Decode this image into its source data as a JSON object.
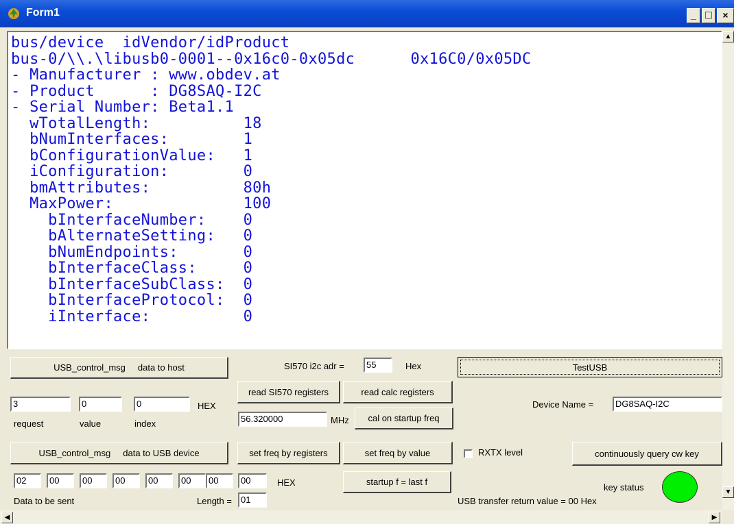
{
  "window": {
    "title": "Form1"
  },
  "titlebar_buttons": {
    "minimize": "_",
    "maximize": "□",
    "close": "×"
  },
  "memo_lines": [
    "bus/device  idVendor/idProduct",
    "bus-0/\\\\.\\libusb0-0001--0x16c0-0x05dc      0x16C0/0x05DC",
    "- Manufacturer : www.obdev.at",
    "- Product      : DG8SAQ-I2C",
    "- Serial Number: Beta1.1",
    "  wTotalLength:          18",
    "  bNumInterfaces:        1",
    "  bConfigurationValue:   1",
    "  iConfiguration:        0",
    "  bmAttributes:          80h",
    "  MaxPower:              100",
    "    bInterfaceNumber:    0",
    "    bAlternateSetting:   0",
    "    bNumEndpoints:       0",
    "    bInterfaceClass:     0",
    "    bInterfaceSubClass:  0",
    "    bInterfaceProtocol:  0",
    "    iInterface:          0"
  ],
  "memo_color": "#1414d8",
  "controls": {
    "usb_msg_to_host_button": "USB_control_msg     data to host",
    "request_value": "3",
    "value_value": "0",
    "index_value": "0",
    "hex_label1": "HEX",
    "request_label": "request",
    "value_label": "value",
    "index_label": "index",
    "usb_msg_to_device_button": "USB_control_msg     data to USB device",
    "data_bytes": [
      "02",
      "00",
      "00",
      "00",
      "00",
      "00",
      "00",
      "00"
    ],
    "hex_label2": "HEX",
    "data_to_be_sent_label": "Data to be sent",
    "length_label": "Length =",
    "length_value": "01",
    "si570_adr_label": "SI570 i2c adr =",
    "si570_adr_value": "55",
    "hex_label3": "Hex",
    "read_si570_button": "read SI570 registers",
    "read_calc_button": "read calc registers",
    "freq_value": "56.320000",
    "mhz_label": "MHz",
    "cal_startup_button": "cal on startup freq",
    "set_freq_registers_button": "set freq by registers",
    "set_freq_value_button": "set freq by value",
    "startup_last_button": "startup f = last f",
    "test_usb_button": "TestUSB",
    "device_name_label": "Device Name =",
    "device_name_value": "DG8SAQ-I2C",
    "rxtx_label": "RXTX level",
    "query_cw_button": "continuously query cw key",
    "key_status_label": "key status",
    "key_status_color": "#00ee00",
    "usb_return_label": "USB transfer return value = 00 Hex"
  }
}
